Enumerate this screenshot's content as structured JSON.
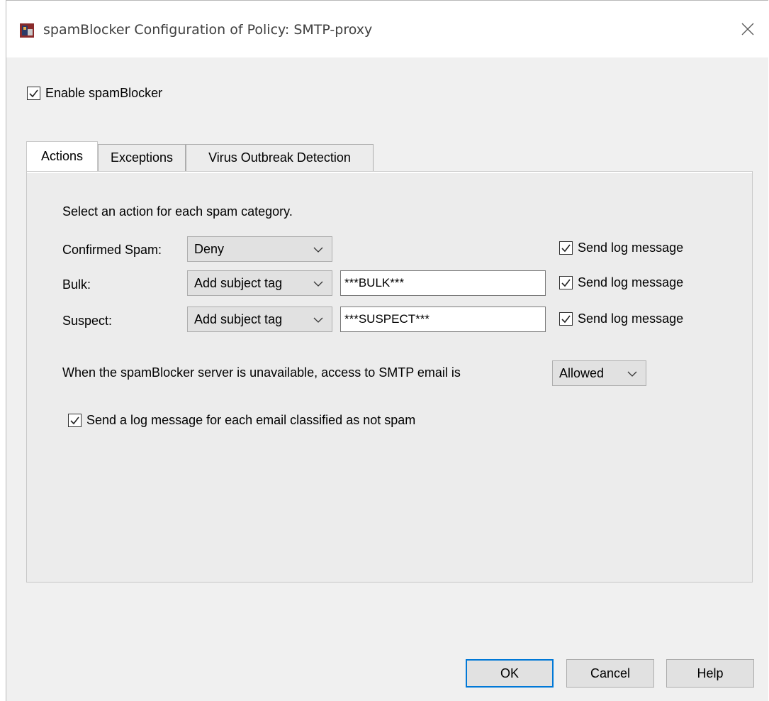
{
  "window": {
    "title": "spamBlocker Configuration of Policy: SMTP-proxy",
    "close_icon": "close-icon",
    "app_icon": "firebox-app-icon"
  },
  "enable": {
    "label": "Enable spamBlocker",
    "checked": true
  },
  "tabs": [
    {
      "label": "Actions",
      "active": true
    },
    {
      "label": "Exceptions",
      "active": false
    },
    {
      "label": "Virus Outbreak Detection",
      "active": false
    }
  ],
  "actions": {
    "intro": "Select an action for each spam category.",
    "rows": [
      {
        "label": "Confirmed Spam:",
        "action": "Deny",
        "tag": "",
        "log_label": "Send log message",
        "log_checked": true
      },
      {
        "label": "Bulk:",
        "action": "Add subject tag",
        "tag": "***BULK***",
        "log_label": "Send log message",
        "log_checked": true
      },
      {
        "label": "Suspect:",
        "action": "Add subject tag",
        "tag": "***SUSPECT***",
        "log_label": "Send log message",
        "log_checked": true
      }
    ],
    "unavailable_text": "When the spamBlocker server is unavailable, access to SMTP email is",
    "unavailable_value": "Allowed",
    "not_spam_log": {
      "label": "Send a log message for each email classified as not spam",
      "checked": true
    }
  },
  "buttons": {
    "ok": "OK",
    "cancel": "Cancel",
    "help": "Help"
  },
  "colors": {
    "default_button_border": "#0078d7",
    "window_bg": "#f0f0f0"
  }
}
